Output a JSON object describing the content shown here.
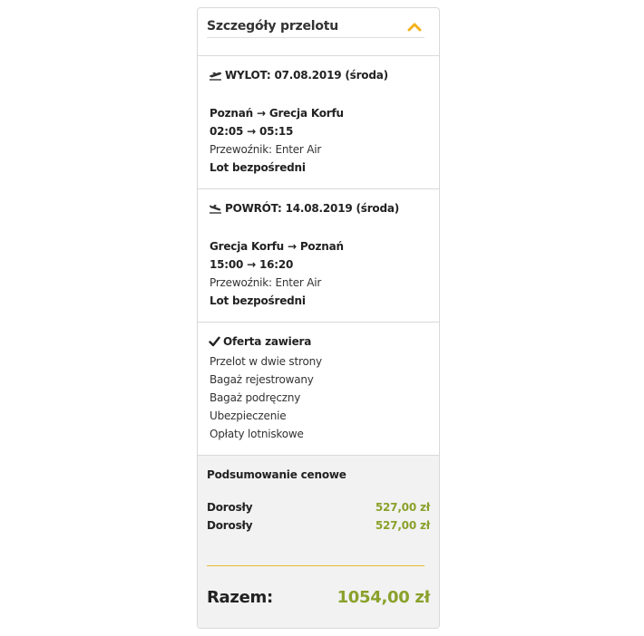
{
  "header": {
    "title": "Szczegóły przelotu"
  },
  "outbound": {
    "title": "WYLOT: 07.08.2019 (środa)",
    "route": "Poznań → Grecja Korfu",
    "times": "02:05 → 05:15",
    "carrier": "Przewoźnik: Enter Air",
    "type": "Lot bezpośredni"
  },
  "return": {
    "title": "POWRÓT: 14.08.2019 (środa)",
    "route": "Grecja Korfu → Poznań",
    "times": "15:00 → 16:20",
    "carrier": "Przewoźnik: Enter Air",
    "type": "Lot bezpośredni"
  },
  "includes": {
    "title": "Oferta zawiera",
    "items": [
      "Przelot w dwie strony",
      "Bagaż rejestrowany",
      "Bagaż podręczny",
      "Ubezpieczenie",
      "Opłaty lotniskowe"
    ]
  },
  "summary": {
    "title": "Podsumowanie cenowe",
    "rows": [
      {
        "label": "Dorosły",
        "value": "527,00 zł"
      },
      {
        "label": "Dorosły",
        "value": "527,00 zł"
      }
    ],
    "total_label": "Razem:",
    "total_value": "1054,00 zł"
  },
  "colors": {
    "accent_yellow": "#f2b21b",
    "price_green": "#8aa12b",
    "summary_bg": "#f2f2f2",
    "border": "#d9d9d9"
  },
  "icons": {
    "collapse": "chevron-up-icon",
    "departure": "plane-departure-icon",
    "arrival": "plane-arrival-icon",
    "check": "check-icon"
  }
}
